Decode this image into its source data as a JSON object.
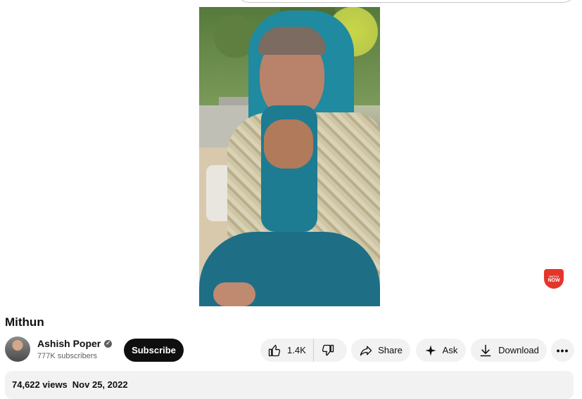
{
  "video": {
    "title": "Mithun"
  },
  "badge": {
    "top_text": "WATCH",
    "main_text": "NOW"
  },
  "channel": {
    "name": "Ashish Poper",
    "subscribers": "777K subscribers",
    "verified_icon": "check-icon"
  },
  "actions": {
    "subscribe_label": "Subscribe",
    "like_count": "1.4K",
    "share_label": "Share",
    "ask_label": "Ask",
    "download_label": "Download",
    "more_label": "•••"
  },
  "description": {
    "views": "74,622 views",
    "date": "Nov 25, 2022"
  },
  "colors": {
    "subscribe_bg": "#0f0f0f",
    "pill_bg": "#f2f2f2",
    "badge_red": "#e5352b"
  }
}
